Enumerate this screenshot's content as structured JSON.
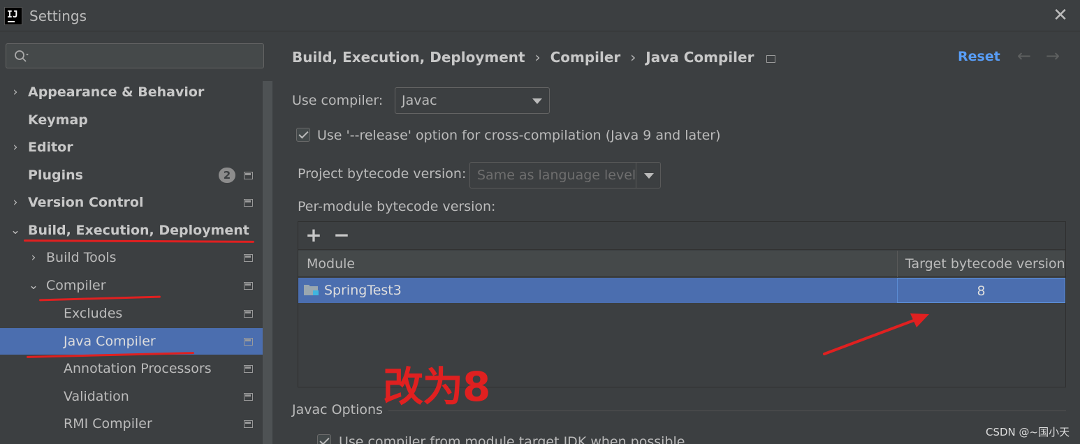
{
  "window": {
    "title": "Settings",
    "app_icon": "IJ"
  },
  "search": {
    "value": "",
    "placeholder": ""
  },
  "tree": {
    "items": [
      {
        "label": "Appearance & Behavior"
      },
      {
        "label": "Keymap"
      },
      {
        "label": "Editor"
      },
      {
        "label": "Plugins",
        "badge": "2"
      },
      {
        "label": "Version Control"
      },
      {
        "label": "Build, Execution, Deployment"
      },
      {
        "label": "Build Tools"
      },
      {
        "label": "Compiler"
      },
      {
        "label": "Excludes"
      },
      {
        "label": "Java Compiler"
      },
      {
        "label": "Annotation Processors"
      },
      {
        "label": "Validation"
      },
      {
        "label": "RMI Compiler"
      }
    ]
  },
  "breadcrumb": [
    "Build, Execution, Deployment",
    "Compiler",
    "Java Compiler"
  ],
  "breadcrumb_sep": "›",
  "header": {
    "reset": "Reset",
    "back": "←",
    "forward": "→"
  },
  "form": {
    "use_compiler_label": "Use compiler:",
    "use_compiler_value": "Javac",
    "release_option_label": "Use '--release' option for cross-compilation (Java 9 and later)",
    "project_bytecode_label": "Project bytecode version:",
    "project_bytecode_value": "Same as language level",
    "per_module_label": "Per-module bytecode version:"
  },
  "table": {
    "add": "+",
    "remove": "−",
    "columns": [
      "Module",
      "Target bytecode version"
    ],
    "rows": [
      {
        "module": "SpringTest3",
        "target": "8"
      }
    ]
  },
  "javac_options": {
    "title": "Javac Options",
    "module_target_jdk_label": "Use compiler from module target JDK when possible"
  },
  "annotation": {
    "text": "改为8",
    "color": "#e02020"
  },
  "watermark": "CSDN @~国小天",
  "colors": {
    "selection": "#4b6eaf",
    "link": "#589df6",
    "background": "#3c3f41"
  }
}
